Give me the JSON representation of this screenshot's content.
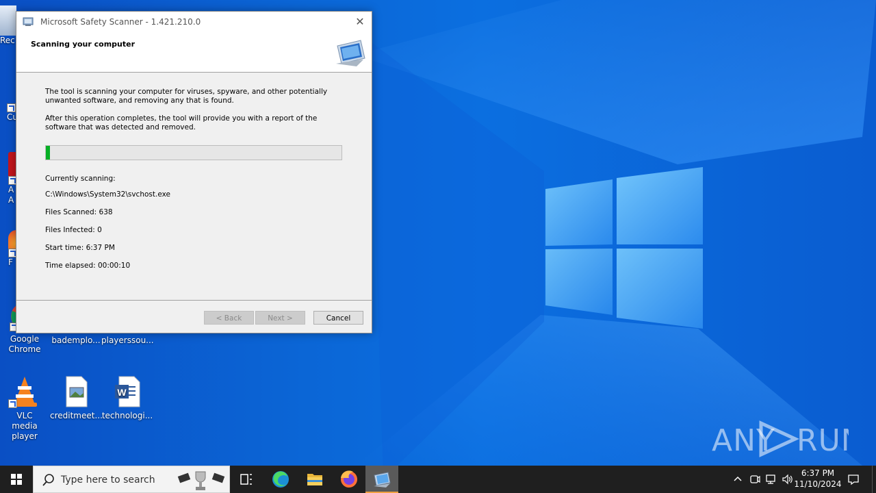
{
  "window": {
    "title": "Microsoft Safety Scanner - 1.421.210.0",
    "heading": "Scanning your computer",
    "paragraph1": "The tool is scanning your computer for viruses, spyware, and other potentially unwanted software, and removing any that is found.",
    "paragraph2": "After this operation completes, the tool will provide you with a report of the software that was detected and removed.",
    "progress_fraction": 0.015,
    "currently_scanning_label": "Currently scanning:",
    "current_file": "C:\\Windows\\System32\\svchost.exe",
    "files_scanned": "Files Scanned: 638",
    "files_infected": "Files Infected: 0",
    "start_time": "Start time: 6:37 PM",
    "time_elapsed": "Time elapsed: 00:00:10",
    "buttons": {
      "back": "< Back",
      "next": "Next >",
      "cancel": "Cancel"
    }
  },
  "desktop": {
    "partial_labels": {
      "recycle": "Rec",
      "item2": "Cu",
      "item3a": "A",
      "item3b": "A",
      "item4": "F"
    },
    "icons": [
      {
        "label": "Google Chrome",
        "icon": "chrome-icon"
      },
      {
        "label": "bademplo...",
        "icon": "file-icon"
      },
      {
        "label": "playerssou...",
        "icon": "file-icon"
      },
      {
        "label": "VLC media player",
        "icon": "vlc-icon"
      },
      {
        "label": "creditmeet...",
        "icon": "image-file-icon"
      },
      {
        "label": "technologi...",
        "icon": "word-doc-icon"
      }
    ]
  },
  "watermark": "ANY RUN",
  "taskbar": {
    "search_placeholder": "Type here to search",
    "time": "6:37 PM",
    "date": "11/10/2024",
    "accent": "#f0a040"
  }
}
